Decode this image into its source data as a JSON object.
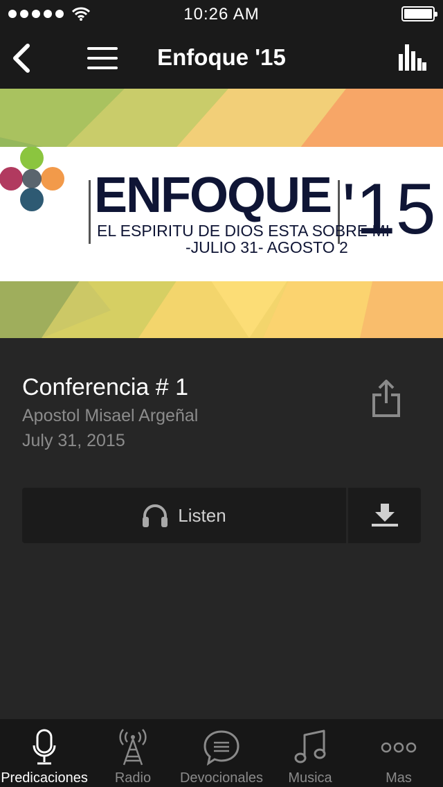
{
  "status_bar": {
    "time": "10:26 AM"
  },
  "nav": {
    "title": "Enfoque '15"
  },
  "banner": {
    "wordmark": "ENFOQUE",
    "year": "'15",
    "subtitle": "EL ESPIRITU DE DIOS ESTA SOBRE MI",
    "dates": "-JULIO 31- AGOSTO 2"
  },
  "sermon": {
    "title": "Conferencia # 1",
    "speaker": "Apostol Misael Argeñal",
    "date": "July 31, 2015"
  },
  "actions": {
    "listen_label": "Listen"
  },
  "tabs": [
    {
      "label": "Predicaciones",
      "icon": "microphone-icon",
      "active": true
    },
    {
      "label": "Radio",
      "icon": "radio-tower-icon",
      "active": false
    },
    {
      "label": "Devocionales",
      "icon": "speech-bubble-icon",
      "active": false
    },
    {
      "label": "Musica",
      "icon": "music-note-icon",
      "active": false
    },
    {
      "label": "Mas",
      "icon": "more-dots-icon",
      "active": false
    }
  ],
  "colors": {
    "background": "#262626",
    "bars": "#1a1a1a",
    "tabbar": "#171717",
    "muted_text": "#8c8c8c",
    "logo_navy": "#0f1535"
  }
}
